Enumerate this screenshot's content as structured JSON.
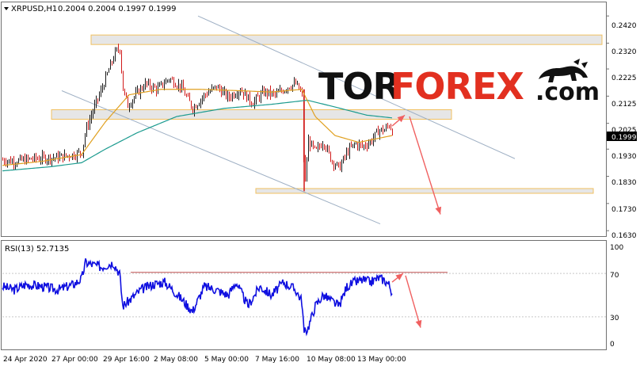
{
  "header": {
    "symbol": "XRPUSD,H1",
    "ohlc": "0.2004 0.2004 0.1997 0.1999"
  },
  "watermark": {
    "part1": "TOR",
    "part2": "FOREX",
    "part3": ".com"
  },
  "colors": {
    "candle_up": "#1a1a1a",
    "candle_down": "#d11a1a",
    "ma_fast": "#e0a020",
    "ma_slow": "#1c9b8f",
    "channel": "#9fb0c4",
    "zone_fill": "#e6e6e6",
    "zone_border": "#f0c060",
    "arrow": "#f06060",
    "rsi": "#1010e0",
    "rsi_resistance": "#c05050",
    "grid": "#c8c8c8",
    "price_tag": "#000000"
  },
  "price_axis": {
    "ticks": [
      "0.2420",
      "0.2320",
      "0.2225",
      "0.2125",
      "0.2025",
      "0.1930",
      "0.1830",
      "0.1730",
      "0.1630"
    ],
    "current": "0.1999"
  },
  "rsi_panel": {
    "label": "RSI(13) 52.7135",
    "ticks": [
      "100",
      "70",
      "30",
      "0"
    ]
  },
  "time_axis": {
    "labels": [
      "24 Apr 2020",
      "27 Apr 00:00",
      "29 Apr 16:00",
      "2 May 08:00",
      "5 May 00:00",
      "7 May 16:00",
      "10 May 08:00",
      "13 May 00:00"
    ]
  },
  "chart_data": {
    "type": "candlestick",
    "symbol": "XRPUSD",
    "timeframe": "H1",
    "ylim": [
      0.161,
      0.247
    ],
    "rsi_ylim": [
      0,
      100
    ],
    "price_path_keypoints": [
      [
        0,
        0.189
      ],
      [
        15,
        0.1885
      ],
      [
        40,
        0.1895
      ],
      [
        70,
        0.19
      ],
      [
        90,
        0.191
      ],
      [
        100,
        0.192
      ],
      [
        105,
        0.2
      ],
      [
        115,
        0.208
      ],
      [
        125,
        0.215
      ],
      [
        135,
        0.223
      ],
      [
        143,
        0.229
      ],
      [
        148,
        0.23
      ],
      [
        152,
        0.215
      ],
      [
        158,
        0.209
      ],
      [
        168,
        0.213
      ],
      [
        180,
        0.217
      ],
      [
        195,
        0.215
      ],
      [
        210,
        0.219
      ],
      [
        225,
        0.216
      ],
      [
        240,
        0.208
      ],
      [
        255,
        0.213
      ],
      [
        270,
        0.216
      ],
      [
        285,
        0.212
      ],
      [
        300,
        0.215
      ],
      [
        315,
        0.21
      ],
      [
        330,
        0.214
      ],
      [
        345,
        0.213
      ],
      [
        360,
        0.216
      ],
      [
        370,
        0.217
      ],
      [
        378,
        0.213
      ],
      [
        381,
        0.178
      ],
      [
        386,
        0.196
      ],
      [
        395,
        0.192
      ],
      [
        405,
        0.196
      ],
      [
        415,
        0.189
      ],
      [
        425,
        0.186
      ],
      [
        435,
        0.192
      ],
      [
        445,
        0.195
      ],
      [
        455,
        0.194
      ],
      [
        465,
        0.196
      ],
      [
        475,
        0.2
      ],
      [
        482,
        0.2
      ],
      [
        488,
        0.202
      ],
      [
        492,
        0.1999
      ]
    ],
    "rsi_path_keypoints": [
      [
        0,
        58
      ],
      [
        15,
        55
      ],
      [
        30,
        60
      ],
      [
        50,
        58
      ],
      [
        70,
        55
      ],
      [
        90,
        60
      ],
      [
        100,
        65
      ],
      [
        105,
        80
      ],
      [
        115,
        78
      ],
      [
        125,
        76
      ],
      [
        140,
        80
      ],
      [
        148,
        70
      ],
      [
        152,
        40
      ],
      [
        160,
        45
      ],
      [
        175,
        55
      ],
      [
        190,
        60
      ],
      [
        205,
        62
      ],
      [
        215,
        55
      ],
      [
        228,
        45
      ],
      [
        240,
        35
      ],
      [
        255,
        58
      ],
      [
        270,
        55
      ],
      [
        285,
        50
      ],
      [
        295,
        62
      ],
      [
        310,
        40
      ],
      [
        325,
        58
      ],
      [
        340,
        50
      ],
      [
        355,
        62
      ],
      [
        370,
        55
      ],
      [
        378,
        45
      ],
      [
        381,
        15
      ],
      [
        386,
        20
      ],
      [
        395,
        40
      ],
      [
        405,
        50
      ],
      [
        415,
        45
      ],
      [
        425,
        40
      ],
      [
        435,
        58
      ],
      [
        445,
        62
      ],
      [
        455,
        64
      ],
      [
        465,
        62
      ],
      [
        475,
        66
      ],
      [
        482,
        64
      ],
      [
        488,
        60
      ],
      [
        492,
        52.7
      ]
    ],
    "ma_fast_keypoints": [
      [
        0,
        0.187
      ],
      [
        50,
        0.1885
      ],
      [
        100,
        0.191
      ],
      [
        130,
        0.203
      ],
      [
        160,
        0.213
      ],
      [
        200,
        0.215
      ],
      [
        250,
        0.215
      ],
      [
        300,
        0.2145
      ],
      [
        340,
        0.214
      ],
      [
        378,
        0.215
      ],
      [
        395,
        0.205
      ],
      [
        420,
        0.198
      ],
      [
        450,
        0.1955
      ],
      [
        492,
        0.198
      ]
    ],
    "ma_slow_keypoints": [
      [
        0,
        0.185
      ],
      [
        60,
        0.1865
      ],
      [
        100,
        0.188
      ],
      [
        130,
        0.193
      ],
      [
        170,
        0.199
      ],
      [
        220,
        0.205
      ],
      [
        280,
        0.208
      ],
      [
        340,
        0.2095
      ],
      [
        385,
        0.211
      ],
      [
        420,
        0.2085
      ],
      [
        460,
        0.2055
      ],
      [
        492,
        0.2045
      ]
    ],
    "zones": [
      {
        "x0": 112,
        "x1": 757,
        "y0": 0.2315,
        "y1": 0.235
      },
      {
        "x0": 62,
        "x1": 567,
        "y0": 0.204,
        "y1": 0.2075
      },
      {
        "x0": 320,
        "x1": 746,
        "y0": 0.177,
        "y1": 0.1785
      }
    ],
    "channel_lines": [
      {
        "x0": 247,
        "y0": 0.242,
        "x1": 647,
        "y1": 0.1895
      },
      {
        "x0": 75,
        "y0": 0.2145,
        "x1": 477,
        "y1": 0.1655
      }
    ],
    "forecast_arrows": [
      {
        "x0": 492,
        "y0": 0.2015,
        "x1": 508,
        "y1": 0.2055
      },
      {
        "x0": 514,
        "y0": 0.205,
        "x1": 553,
        "y1": 0.169
      }
    ],
    "rsi_resistance": {
      "x0": 162,
      "x1": 562,
      "value": 71
    },
    "rsi_forecast_arrows": [
      {
        "x0": 492,
        "y0": 62,
        "x1": 506,
        "y1": 70
      },
      {
        "x0": 509,
        "y0": 68,
        "x1": 528,
        "y1": 20
      }
    ]
  }
}
